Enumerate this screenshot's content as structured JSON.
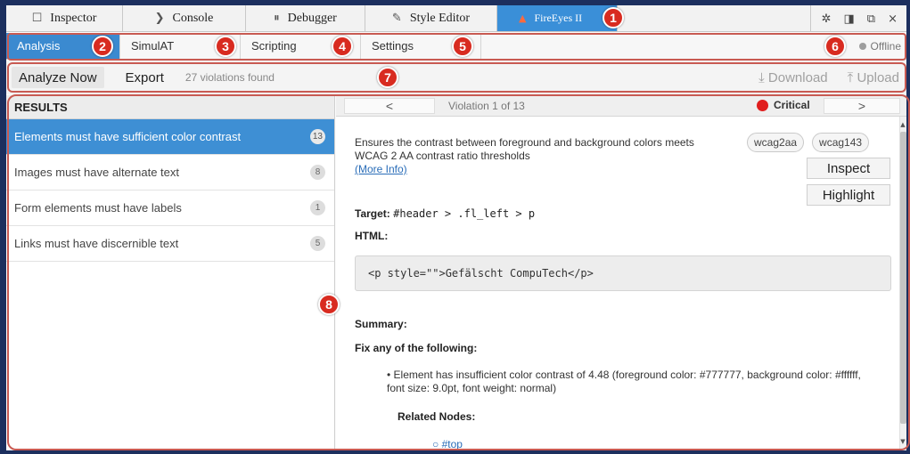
{
  "devtools_tabs": [
    {
      "label": "Inspector",
      "icon": "square-icon",
      "glyph": "☐"
    },
    {
      "label": "Console",
      "icon": "chevron-right-icon",
      "glyph": "❯"
    },
    {
      "label": "Debugger",
      "icon": "pause-circle-icon",
      "glyph": "⏸"
    },
    {
      "label": "Style Editor",
      "icon": "pencil-icon",
      "glyph": "✎"
    },
    {
      "label": "FireEyes II",
      "icon": "fireeyes-icon",
      "glyph": "▲",
      "active": true
    }
  ],
  "devtools_controls": [
    {
      "name": "gear-icon",
      "glyph": "✲"
    },
    {
      "name": "dock-side-icon",
      "glyph": "◨"
    },
    {
      "name": "popout-icon",
      "glyph": "⧉"
    },
    {
      "name": "close-icon",
      "glyph": "×"
    }
  ],
  "subtabs": [
    {
      "label": "Analysis",
      "active": true
    },
    {
      "label": "SimulAT"
    },
    {
      "label": "Scripting"
    },
    {
      "label": "Settings"
    }
  ],
  "status": {
    "label": "Offline",
    "color": "#9e9e9e"
  },
  "toolbar": {
    "analyze_label": "Analyze Now",
    "export_label": "Export",
    "violations_count": "27 violations found",
    "download_label": "Download",
    "download_icon": "download-icon",
    "download_glyph": "⤓",
    "upload_label": "Upload",
    "upload_icon": "upload-icon",
    "upload_glyph": "⤒"
  },
  "results": {
    "header": "RESULTS",
    "items": [
      {
        "text": "Elements must have sufficient color contrast",
        "count": "13",
        "selected": true
      },
      {
        "text": "Images must have alternate text",
        "count": "8"
      },
      {
        "text": "Form elements must have labels",
        "count": "1"
      },
      {
        "text": "Links must have discernible text",
        "count": "5"
      }
    ]
  },
  "violation": {
    "prev_label": "<",
    "next_label": ">",
    "counter": "Violation 1 of 13",
    "severity": "Critical",
    "severity_color": "#e01e1e",
    "description": "Ensures the contrast between foreground and background colors meets WCAG 2 AA contrast ratio thresholds",
    "more_info": "(More Info)",
    "tags": [
      "wcag2aa",
      "wcag143"
    ],
    "inspect_label": "Inspect",
    "highlight_label": "Highlight",
    "target_label": "Target:",
    "target_value": "#header > .fl_left > p",
    "html_label": "HTML:",
    "html_snippet": "<p style=\"\">Gefälscht CompuTech</p>",
    "summary_label": "Summary:",
    "fix_label": "Fix any of the following:",
    "fix_items": [
      "Element has insufficient color contrast of 4.48 (foreground color: #777777, background color: #ffffff, font size: 9.0pt, font weight: normal)"
    ],
    "related_label": "Related Nodes:",
    "related_nodes": [
      "#top"
    ]
  },
  "callouts": [
    "1",
    "2",
    "3",
    "4",
    "5",
    "6",
    "7",
    "8"
  ],
  "theme": {
    "accent": "#3a8fd8",
    "callout": "#d82b20",
    "outline": "#c85a52",
    "background": "#1c2f5e"
  }
}
